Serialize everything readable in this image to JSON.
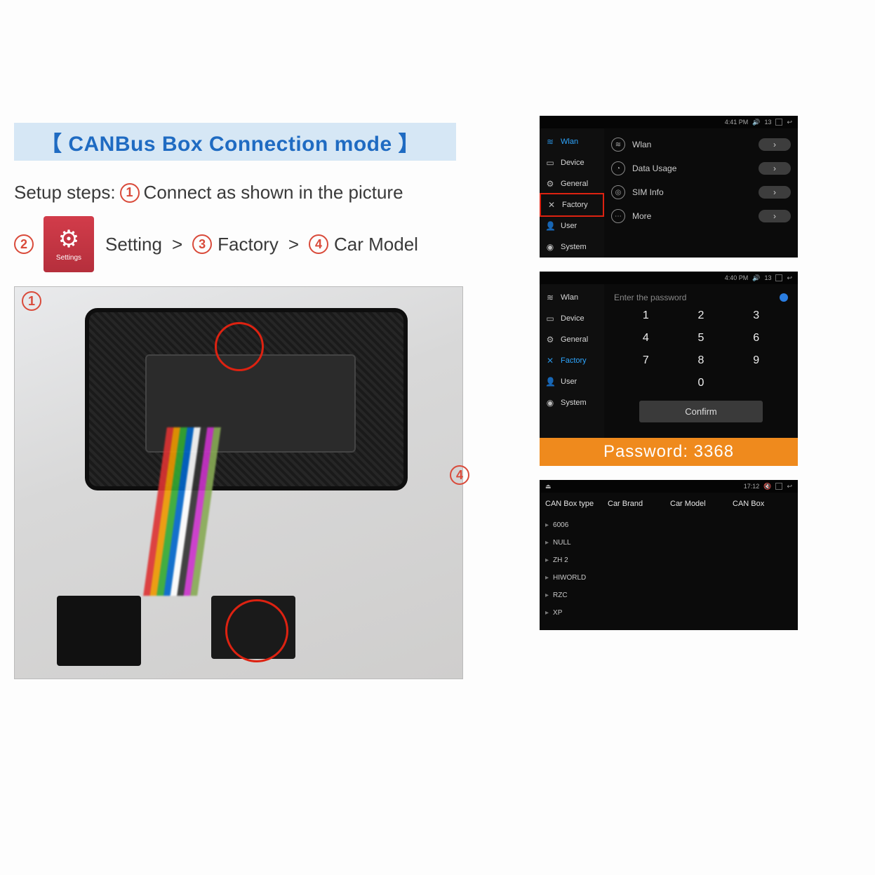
{
  "title": "【 CANBus Box Connection mode 】",
  "steps": {
    "label": "Setup steps:",
    "s1_text": "Connect as shown in the picture",
    "s2_text": "Setting",
    "s3_text": "Factory",
    "s4_text": "Car Model",
    "gt": ">",
    "n1": "1",
    "n2": "2",
    "n3": "3",
    "n4": "4",
    "settings_icon_label": "Settings"
  },
  "screenA": {
    "status_time": "4:41 PM",
    "status_badge": "13",
    "sidebar": [
      {
        "icon": "≋",
        "label": "Wlan",
        "active": true
      },
      {
        "icon": "▭",
        "label": "Device"
      },
      {
        "icon": "⚙",
        "label": "General"
      },
      {
        "icon": "✕",
        "label": "Factory",
        "boxed": true
      },
      {
        "icon": "👤",
        "label": "User"
      },
      {
        "icon": "◉",
        "label": "System"
      }
    ],
    "rows": [
      {
        "icon": "≋",
        "label": "Wlan"
      },
      {
        "icon": "◔",
        "label": "Data Usage"
      },
      {
        "icon": "◎",
        "label": "SIM Info"
      },
      {
        "icon": "⋯",
        "label": "More"
      }
    ]
  },
  "screenB": {
    "status_time": "4:40 PM",
    "status_badge": "13",
    "sidebar": [
      {
        "icon": "≋",
        "label": "Wlan"
      },
      {
        "icon": "▭",
        "label": "Device"
      },
      {
        "icon": "⚙",
        "label": "General"
      },
      {
        "icon": "✕",
        "label": "Factory",
        "active": true
      },
      {
        "icon": "👤",
        "label": "User"
      },
      {
        "icon": "◉",
        "label": "System"
      }
    ],
    "prompt": "Enter the password",
    "keys": [
      "1",
      "2",
      "3",
      "4",
      "5",
      "6",
      "7",
      "8",
      "9",
      "0"
    ],
    "confirm": "Confirm",
    "password_banner": "Password: 3368"
  },
  "screenC": {
    "status_time": "17:12",
    "tabs": [
      "CAN Box type",
      "Car Brand",
      "Car Model",
      "CAN Box"
    ],
    "list": [
      "6006",
      "NULL",
      "ZH 2",
      "HIWORLD",
      "RZC",
      "XP"
    ]
  }
}
